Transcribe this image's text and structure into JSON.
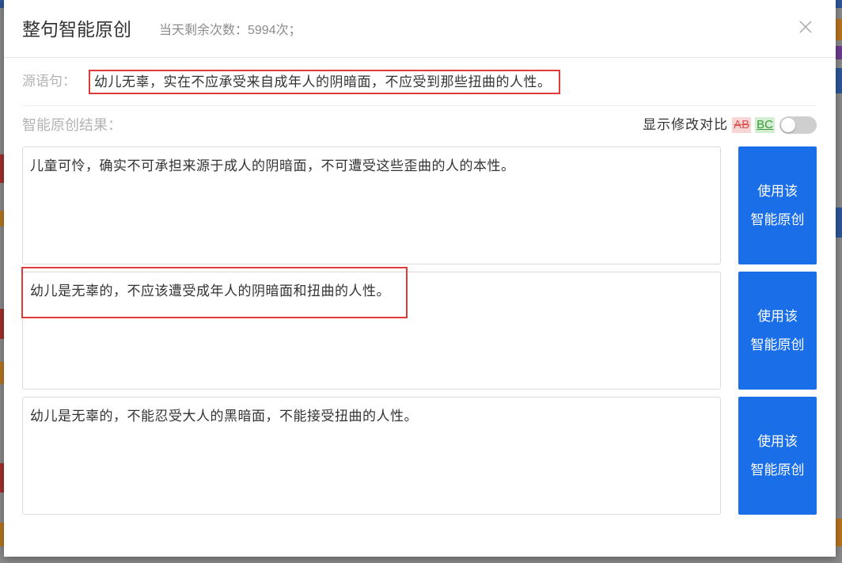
{
  "dialog": {
    "title": "整句智能原创",
    "quota": "当天剩余次数：5994次；",
    "close_icon": "close-icon"
  },
  "source": {
    "label": "源语句：",
    "sentence": "幼儿无辜，实在不应承受来自成年人的阴暗面，不应受到那些扭曲的人性。"
  },
  "results": {
    "label": "智能原创结果：",
    "compare": {
      "label": "显示修改对比",
      "removed_sample": "AB",
      "added_sample": "BC",
      "enabled": false
    },
    "use_button": {
      "line1": "使用该",
      "line2": "智能原创"
    },
    "items": [
      {
        "text": "儿童可怜，确实不可承担来源于成人的阴暗面，不可遭受这些歪曲的人的本性。"
      },
      {
        "text": "幼儿是无辜的，不应该遭受成年人的阴暗面和扭曲的人性。"
      },
      {
        "text": "幼儿是无辜的，不能忍受大人的黑暗面，不能接受扭曲的人性。"
      }
    ]
  },
  "colors": {
    "primary": "#1a6ee8",
    "highlight": "#e03a3a",
    "removed_text": "#d9534f",
    "removed_bg": "#f8d6d6",
    "added_text": "#3a9a3a",
    "added_bg": "#d4eed4",
    "toggle_off": "#cfcfcf",
    "overlay": "#8a8a8a"
  }
}
